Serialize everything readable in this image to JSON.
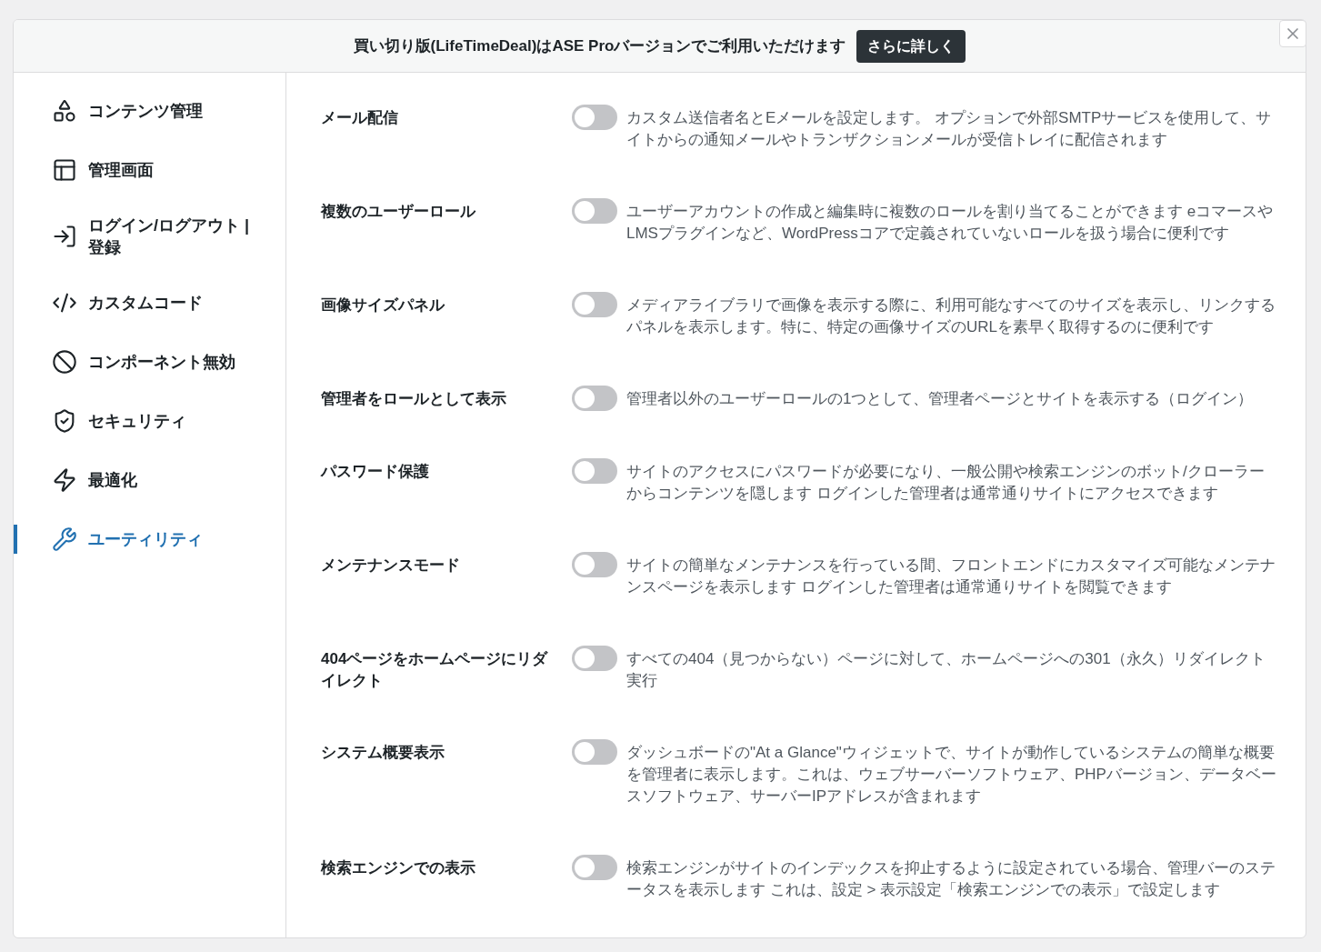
{
  "banner": {
    "text": "買い切り版(LifeTimeDeal)はASE Proバージョンでご利用いただけます",
    "button": "さらに詳しく"
  },
  "sidebar": {
    "items": [
      {
        "label": "コンテンツ管理",
        "selected": false
      },
      {
        "label": "管理画面",
        "selected": false
      },
      {
        "label": "ログイン/ログアウト | 登録",
        "selected": false
      },
      {
        "label": "カスタムコード",
        "selected": false
      },
      {
        "label": "コンポーネント無効",
        "selected": false
      },
      {
        "label": "セキュリティ",
        "selected": false
      },
      {
        "label": "最適化",
        "selected": false
      },
      {
        "label": "ユーティリティ",
        "selected": true
      }
    ]
  },
  "settings": [
    {
      "title": "メール配信",
      "on": false,
      "description": "カスタム送信者名とEメールを設定します。 オプションで外部SMTPサービスを使用して、サイトからの通知メールやトランザクションメールが受信トレイに配信されます"
    },
    {
      "title": "複数のユーザーロール",
      "on": false,
      "description": "ユーザーアカウントの作成と編集時に複数のロールを割り当てることができます eコマースやLMSプラグインなど、WordPressコアで定義されていないロールを扱う場合に便利です"
    },
    {
      "title": "画像サイズパネル",
      "on": false,
      "description": "メディアライブラリで画像を表示する際に、利用可能なすべてのサイズを表示し、リンクするパネルを表示します。特に、特定の画像サイズのURLを素早く取得するのに便利です"
    },
    {
      "title": "管理者をロールとして表示",
      "on": false,
      "description": "管理者以外のユーザーロールの1つとして、管理者ページとサイトを表示する（ログイン）"
    },
    {
      "title": "パスワード保護",
      "on": false,
      "description": "サイトのアクセスにパスワードが必要になり、一般公開や検索エンジンのボット/クローラーからコンテンツを隠します ログインした管理者は通常通りサイトにアクセスできます"
    },
    {
      "title": "メンテナンスモード",
      "on": false,
      "description": "サイトの簡単なメンテナンスを行っている間、フロントエンドにカスタマイズ可能なメンテナンスページを表示します ログインした管理者は通常通りサイトを閲覧できます"
    },
    {
      "title": "404ページをホームページにリダイレクト",
      "on": false,
      "description": "すべての404（見つからない）ページに対して、ホームページへの301（永久）リダイレクト実行"
    },
    {
      "title": "システム概要表示",
      "on": false,
      "description": "ダッシュボードの\"At a Glance\"ウィジェットで、サイトが動作しているシステムの簡単な概要を管理者に表示します。これは、ウェブサーバーソフトウェア、PHPバージョン、データベースソフトウェア、サーバーIPアドレスが含まれます"
    },
    {
      "title": "検索エンジンでの表示",
      "on": false,
      "description": "検索エンジンがサイトのインデックスを抑止するように設定されている場合、管理バーのステータスを表示します これは、設定 > 表示設定「検索エンジンでの表示」で設定します"
    }
  ]
}
